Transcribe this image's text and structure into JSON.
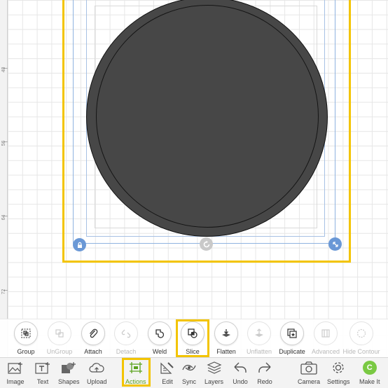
{
  "ruler": {
    "labels": [
      "48",
      "56",
      "64",
      "72"
    ]
  },
  "actions": [
    {
      "name": "group",
      "label": "Group",
      "enabled": true
    },
    {
      "name": "ungroup",
      "label": "UnGroup",
      "enabled": false
    },
    {
      "name": "attach",
      "label": "Attach",
      "enabled": true
    },
    {
      "name": "detach",
      "label": "Detach",
      "enabled": false
    },
    {
      "name": "weld",
      "label": "Weld",
      "enabled": true
    },
    {
      "name": "slice",
      "label": "Slice",
      "enabled": true
    },
    {
      "name": "flatten",
      "label": "Flatten",
      "enabled": true
    },
    {
      "name": "unflatten",
      "label": "Unflatten",
      "enabled": false
    },
    {
      "name": "duplicate",
      "label": "Duplicate",
      "enabled": true
    },
    {
      "name": "advanced",
      "label": "Advanced",
      "enabled": false
    },
    {
      "name": "hide-contour",
      "label": "Hide Contour",
      "enabled": false
    }
  ],
  "toolbar": {
    "image": "Image",
    "text": "Text",
    "shapes": "Shapes",
    "upload": "Upload",
    "actions": "Actions",
    "edit": "Edit",
    "sync": "Sync",
    "layers": "Layers",
    "undo": "Undo",
    "redo": "Redo",
    "camera": "Camera",
    "settings": "Settings",
    "make_it": "Make It",
    "make_it_badge": "C"
  },
  "colors": {
    "highlight": "#f3c400",
    "shape_fill": "#474747",
    "active_tab": "#5aa21c",
    "selection": "#6a98d6"
  }
}
